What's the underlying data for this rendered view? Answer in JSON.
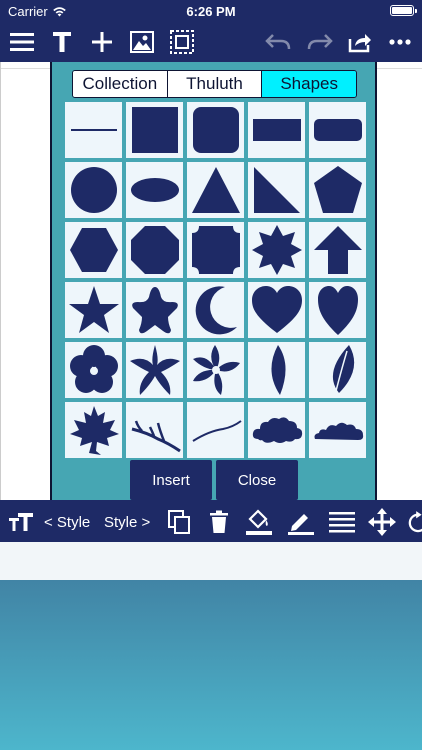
{
  "status": {
    "carrier": "Carrier",
    "time": "6:26 PM"
  },
  "toolbar_icons": [
    "menu-icon",
    "text-icon",
    "add-icon",
    "image-icon",
    "select-frame-icon",
    "undo-icon",
    "redo-icon",
    "share-icon",
    "more-icon"
  ],
  "panel": {
    "tabs": [
      {
        "label": "Collection",
        "active": false
      },
      {
        "label": "Thuluth",
        "active": false
      },
      {
        "label": "Shapes",
        "active": true
      }
    ],
    "shapes": [
      "line-shape",
      "square-shape",
      "rounded-square-shape",
      "rectangle-shape",
      "rounded-rectangle-shape",
      "circle-shape",
      "ellipse-shape",
      "triangle-shape",
      "right-triangle-shape",
      "pentagon-shape",
      "hexagon-shape",
      "octagon-shape",
      "notched-square-shape",
      "eight-point-star-shape",
      "arrow-up-shape",
      "star-shape",
      "rounded-star-shape",
      "crescent-shape",
      "heart-shape",
      "tall-heart-shape",
      "flower-shape",
      "pointed-flower-shape",
      "pinwheel-flower-shape",
      "leaf-shape",
      "veined-leaf-shape",
      "maple-leaf-shape",
      "branch-shape",
      "curve-line-shape",
      "cloud-shape",
      "cloud-wide-shape"
    ],
    "insert_label": "Insert",
    "close_label": "Close"
  },
  "bottombar": {
    "font_size_icon": "font-size-icon",
    "style_prev": "< Style",
    "style_next": "Style >"
  },
  "colors": {
    "bar": "#1e2a66",
    "panel": "#46a6b3",
    "active_tab": "#00f0ff",
    "shape": "#1e2a66",
    "cell": "#eef6fb"
  }
}
